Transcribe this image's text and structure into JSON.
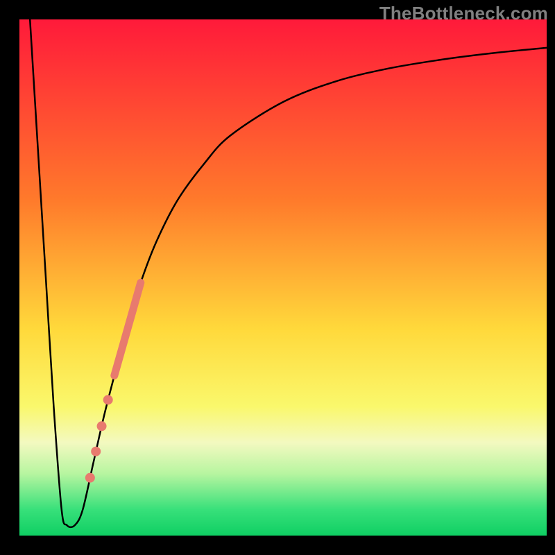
{
  "watermark": "TheBottleneck.com",
  "chart_data": {
    "type": "line",
    "title": "",
    "xlabel": "",
    "ylabel": "",
    "xlim": [
      0,
      100
    ],
    "ylim": [
      0,
      100
    ],
    "gradient_stops": [
      {
        "offset": 0,
        "color": "#ff1a3a"
      },
      {
        "offset": 35,
        "color": "#ff7a2b"
      },
      {
        "offset": 60,
        "color": "#ffd93b"
      },
      {
        "offset": 75,
        "color": "#faf86c"
      },
      {
        "offset": 82,
        "color": "#f3f9c0"
      },
      {
        "offset": 88,
        "color": "#b7f5a0"
      },
      {
        "offset": 95,
        "color": "#37e07a"
      },
      {
        "offset": 100,
        "color": "#0fcf63"
      }
    ],
    "series": [
      {
        "name": "bottleneck-curve",
        "stroke": "#000000",
        "points": [
          {
            "x": 2.0,
            "y": 100.0
          },
          {
            "x": 3.5,
            "y": 75.0
          },
          {
            "x": 5.0,
            "y": 50.0
          },
          {
            "x": 6.5,
            "y": 25.0
          },
          {
            "x": 8.0,
            "y": 5.0
          },
          {
            "x": 9.0,
            "y": 2.0
          },
          {
            "x": 10.5,
            "y": 2.0
          },
          {
            "x": 12.0,
            "y": 5.0
          },
          {
            "x": 14.0,
            "y": 14.0
          },
          {
            "x": 16.0,
            "y": 23.0
          },
          {
            "x": 18.0,
            "y": 31.0
          },
          {
            "x": 20.0,
            "y": 39.0
          },
          {
            "x": 23.0,
            "y": 49.0
          },
          {
            "x": 26.0,
            "y": 57.0
          },
          {
            "x": 30.0,
            "y": 65.0
          },
          {
            "x": 35.0,
            "y": 72.0
          },
          {
            "x": 40.0,
            "y": 77.5
          },
          {
            "x": 50.0,
            "y": 84.0
          },
          {
            "x": 60.0,
            "y": 88.0
          },
          {
            "x": 70.0,
            "y": 90.5
          },
          {
            "x": 80.0,
            "y": 92.2
          },
          {
            "x": 90.0,
            "y": 93.5
          },
          {
            "x": 100.0,
            "y": 94.5
          }
        ]
      },
      {
        "name": "highlight-band",
        "stroke": "#e87a6e",
        "stroke_width": 11,
        "points": [
          {
            "x": 18.0,
            "y": 31.0
          },
          {
            "x": 23.0,
            "y": 49.0
          }
        ]
      }
    ],
    "highlight_dots": {
      "color": "#e87a6e",
      "radius": 7,
      "points": [
        {
          "x": 16.8,
          "y": 26.3
        },
        {
          "x": 15.6,
          "y": 21.2
        },
        {
          "x": 14.5,
          "y": 16.3
        },
        {
          "x": 13.4,
          "y": 11.2
        }
      ]
    }
  }
}
